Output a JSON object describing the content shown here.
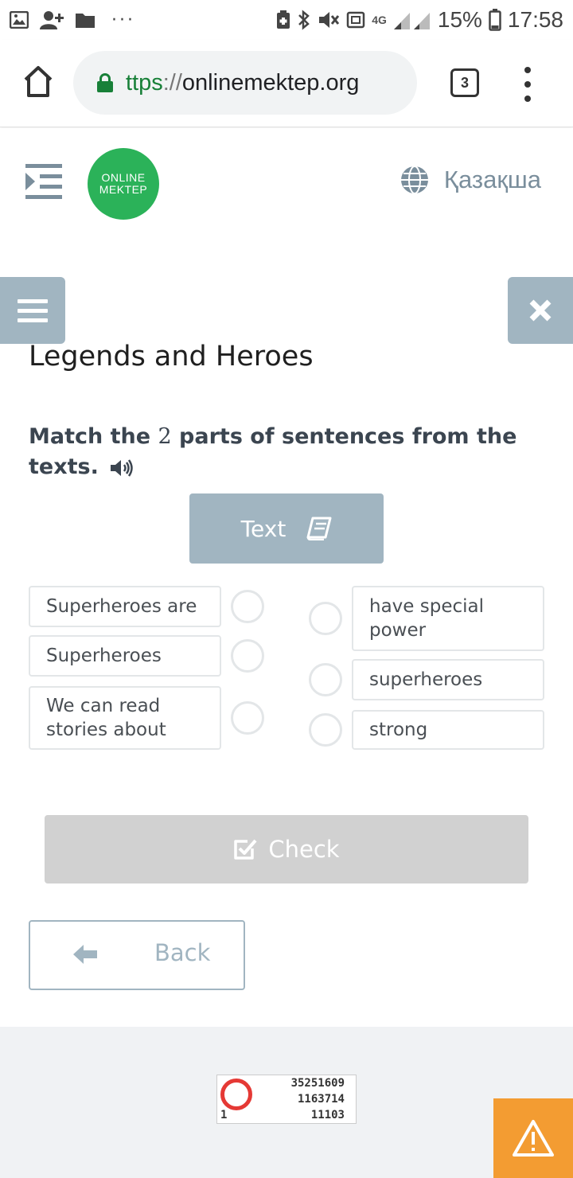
{
  "status_bar": {
    "network": "4G",
    "battery": "15%",
    "time": "17:58",
    "overflow": "···",
    "icons": [
      "gallery-icon",
      "add-contact-icon",
      "folder-icon",
      "battery-saver-icon",
      "bluetooth-icon",
      "mute-icon",
      "sim-icon",
      "signal-icon",
      "battery-icon"
    ]
  },
  "browser": {
    "url_scheme": "ttps",
    "url_sep": "://",
    "url_host": "onlinemektep.org",
    "tab_count": "3"
  },
  "header": {
    "logo_line1": "ONLINE",
    "logo_line2": "MEKTEP",
    "language": "Қазақша",
    "brand_color": "#2bb259",
    "accent_color": "#a1b5c1"
  },
  "lesson": {
    "title": "Legends and Heroes",
    "instruction_pre": "Match the ",
    "instruction_num": "2",
    "instruction_post": " parts of sentences from the texts.",
    "text_button": "Text",
    "left_items": [
      {
        "label": "Superheroes are"
      },
      {
        "label": "Superheroes"
      },
      {
        "label": "We can read stories about"
      }
    ],
    "right_items": [
      {
        "label": "have special power"
      },
      {
        "label": "superheroes"
      },
      {
        "label": "strong"
      }
    ],
    "check_button": "Check",
    "back_button": "Back"
  },
  "footer": {
    "counter_line1": "35251609",
    "counter_line2": "1163714",
    "counter_line3": "11103",
    "counter_left": "1"
  }
}
